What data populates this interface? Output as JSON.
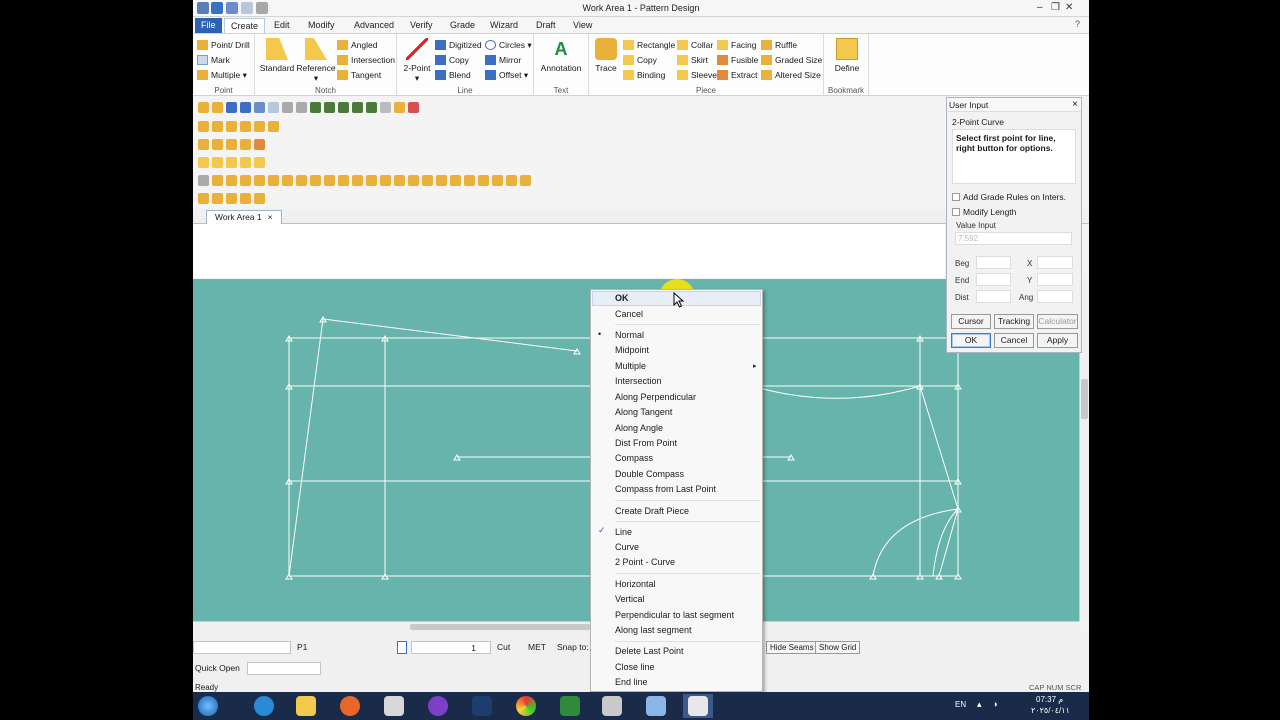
{
  "window": {
    "title": "Work Area 1 - Pattern Design"
  },
  "menu": {
    "tabs": [
      "File",
      "Create",
      "Edit",
      "Modify",
      "Advanced",
      "Verify",
      "Grade",
      "Wizard",
      "Draft",
      "View"
    ],
    "active": "Create"
  },
  "ribbon": {
    "point": {
      "label": "Point",
      "items": [
        "Point/ Drill",
        "Mark",
        "Multiple"
      ]
    },
    "notch": {
      "label": "Notch",
      "big": [
        "Standard",
        "Reference"
      ],
      "items": [
        "Angled",
        "Intersection",
        "Tangent"
      ]
    },
    "line": {
      "label": "Line",
      "big": "2-Point",
      "items": [
        "Digitized",
        "Copy",
        "Blend",
        "Circles",
        "Mirror",
        "Offset"
      ]
    },
    "text": {
      "label": "Text",
      "big": "Annotation"
    },
    "piece": {
      "label": "Piece",
      "big": "Trace",
      "items": [
        "Rectangle",
        "Copy",
        "Binding",
        "Collar",
        "Skirt",
        "Sleeve",
        "Facing",
        "Fusible",
        "Extract",
        "Ruffle",
        "Graded Size",
        "Altered Size"
      ]
    },
    "bookmark": {
      "label": "Bookmark",
      "big": "Define"
    }
  },
  "doc_tab": {
    "label": "Work Area 1",
    "close": "×"
  },
  "context_menu": {
    "items": [
      {
        "label": "OK",
        "bold": true
      },
      {
        "label": "Cancel"
      },
      {
        "label": "Normal",
        "mark": "•"
      },
      {
        "label": "Midpoint"
      },
      {
        "label": "Multiple",
        "submenu": "▸"
      },
      {
        "label": "Intersection"
      },
      {
        "label": "Along Perpendicular"
      },
      {
        "label": "Along Tangent"
      },
      {
        "label": "Along Angle"
      },
      {
        "label": "Dist From Point"
      },
      {
        "label": "Compass"
      },
      {
        "label": "Double Compass"
      },
      {
        "label": "Compass from Last Point"
      },
      {
        "label": "Create Draft Piece"
      },
      {
        "label": "Line",
        "mark": "✓"
      },
      {
        "label": "Curve"
      },
      {
        "label": "2 Point - Curve"
      },
      {
        "label": "Horizontal"
      },
      {
        "label": "Vertical"
      },
      {
        "label": "Perpendicular to last segment"
      },
      {
        "label": "Along last segment"
      },
      {
        "label": "Delete Last Point"
      },
      {
        "label": "Close line"
      },
      {
        "label": "End line"
      }
    ]
  },
  "user_input": {
    "title": "User Input",
    "close": "×",
    "mode": "2-Point Curve",
    "message": "Select first point for line, right button for options.",
    "add_grade_rules": "Add Grade Rules on Inters.",
    "modify_length": "Modify Length",
    "value_input_label": "Value Input",
    "value_input": "7.592",
    "beg_label": "Beg",
    "end_label": "End",
    "dist_label": "Dist",
    "x_label": "X",
    "y_label": "Y",
    "ang_label": "Ang",
    "cursor": "Cursor",
    "tracking": "Tracking",
    "calculator": "Calculator",
    "ok": "OK",
    "cancel": "Cancel",
    "apply": "Apply"
  },
  "status": {
    "piece": "P1",
    "size": "1",
    "cut": "Cut",
    "units": "MET",
    "snap_to": "Snap to:",
    "hide_seams": "Hide Seams",
    "show_grid": "Show Grid",
    "quick_open": "Quick Open",
    "ready": "Ready",
    "indicators": "CAP NUM SCR"
  },
  "taskbar": {
    "lang": "EN",
    "time": "07:37 م",
    "date": "٢٠٢٥/٠٤/١١"
  },
  "colors": {
    "canvas": "#66b4ab",
    "accent": "#2b62b3",
    "highlight": "#ffe600"
  }
}
